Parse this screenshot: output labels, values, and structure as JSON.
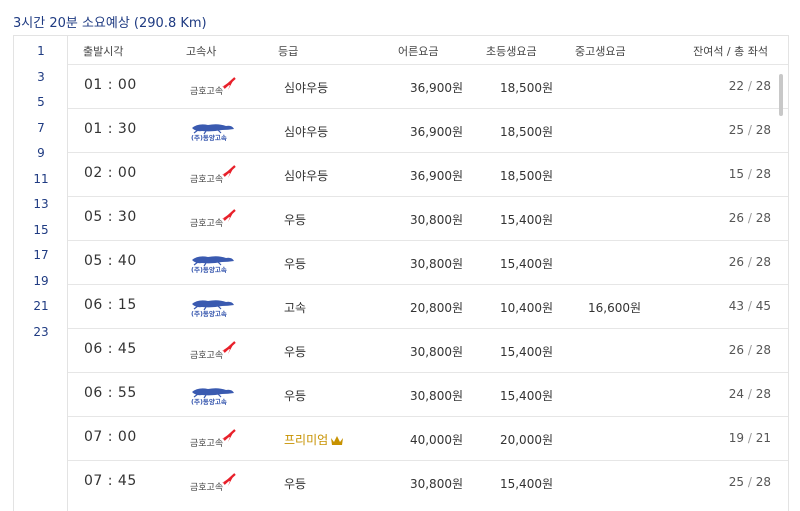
{
  "summary": "3시간 20분 소요예상 (290.8 Km)",
  "hour_index": [
    "1",
    "3",
    "5",
    "7",
    "9",
    "11",
    "13",
    "15",
    "17",
    "19",
    "21",
    "23"
  ],
  "columns": {
    "time": "출발시각",
    "company": "고속사",
    "grade": "등급",
    "adult": "어른요금",
    "child": "초등생요금",
    "teen": "중고생요금",
    "seats": "잔여석 / 총 좌석"
  },
  "company_logos": {
    "kumho": {
      "text": "금호고속",
      "icon": "kumho-bird-logo",
      "color": "#e8202a"
    },
    "dongbu": {
      "text": "(주)동양고속",
      "icon": "greyhound-dog-logo",
      "color": "#3a5ab0"
    }
  },
  "rows": [
    {
      "time": "01 : 00",
      "company": "kumho",
      "company_text": "금호고속",
      "grade": "심야우등",
      "adult": "36,900원",
      "child": "18,500원",
      "teen": "",
      "remain": "22",
      "total": "28",
      "premium": false
    },
    {
      "time": "01 : 30",
      "company": "dongbu",
      "company_text": "(주)동양고속",
      "grade": "심야우등",
      "adult": "36,900원",
      "child": "18,500원",
      "teen": "",
      "remain": "25",
      "total": "28",
      "premium": false
    },
    {
      "time": "02 : 00",
      "company": "kumho",
      "company_text": "금호고속",
      "grade": "심야우등",
      "adult": "36,900원",
      "child": "18,500원",
      "teen": "",
      "remain": "15",
      "total": "28",
      "premium": false
    },
    {
      "time": "05 : 30",
      "company": "kumho",
      "company_text": "금호고속",
      "grade": "우등",
      "adult": "30,800원",
      "child": "15,400원",
      "teen": "",
      "remain": "26",
      "total": "28",
      "premium": false
    },
    {
      "time": "05 : 40",
      "company": "dongbu",
      "company_text": "(주)동양고속",
      "grade": "우등",
      "adult": "30,800원",
      "child": "15,400원",
      "teen": "",
      "remain": "26",
      "total": "28",
      "premium": false
    },
    {
      "time": "06 : 15",
      "company": "dongbu",
      "company_text": "(주)동양고속",
      "grade": "고속",
      "adult": "20,800원",
      "child": "10,400원",
      "teen": "16,600원",
      "remain": "43",
      "total": "45",
      "premium": false
    },
    {
      "time": "06 : 45",
      "company": "kumho",
      "company_text": "금호고속",
      "grade": "우등",
      "adult": "30,800원",
      "child": "15,400원",
      "teen": "",
      "remain": "26",
      "total": "28",
      "premium": false
    },
    {
      "time": "06 : 55",
      "company": "dongbu",
      "company_text": "(주)동양고속",
      "grade": "우등",
      "adult": "30,800원",
      "child": "15,400원",
      "teen": "",
      "remain": "24",
      "total": "28",
      "premium": false
    },
    {
      "time": "07 : 00",
      "company": "kumho",
      "company_text": "금호고속",
      "grade": "프리미엄",
      "adult": "40,000원",
      "child": "20,000원",
      "teen": "",
      "remain": "19",
      "total": "21",
      "premium": true
    },
    {
      "time": "07 : 45",
      "company": "kumho",
      "company_text": "금호고속",
      "grade": "우등",
      "adult": "30,800원",
      "child": "15,400원",
      "teen": "",
      "remain": "25",
      "total": "28",
      "premium": false
    }
  ],
  "seat_separator": "/",
  "premium_icon": "crown-icon",
  "colors": {
    "accent": "#1f3b82",
    "premium": "#c79200",
    "kumho_red": "#e8202a",
    "dongbu_blue": "#3a5ab0"
  }
}
